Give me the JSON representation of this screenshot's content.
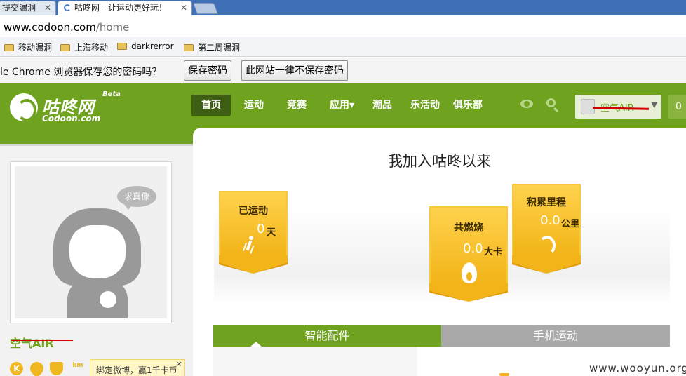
{
  "browser": {
    "tabs": [
      {
        "title": "提交漏洞"
      },
      {
        "title": "咕咚网 - 让运动更好玩！"
      }
    ],
    "url": {
      "host": "www.codoon.com",
      "path": "/home"
    },
    "bookmarks": [
      "移动漏洞",
      "上海移动",
      "darkrerror",
      "第二周漏洞"
    ],
    "password_prompt": {
      "message": "le Chrome 浏览器保存您的密码吗？",
      "save_label": "保存密码",
      "never_label": "此网站一律不保存密码"
    }
  },
  "site": {
    "logo": {
      "cn": "咕咚网",
      "en": "Codoon.com",
      "beta": "Beta"
    },
    "nav": [
      "首页",
      "运动",
      "竞赛",
      "应用▾",
      "潮品",
      "乐活动",
      "俱乐部"
    ],
    "user_name": "空气AIR",
    "message_count": "0"
  },
  "profile": {
    "avatar_bubble": "求真像",
    "name": "空气AIR",
    "icons": [
      "K",
      "",
      "",
      "km"
    ],
    "tooltip": "绑定微博，赢1千卡币",
    "tooltip_close": "×"
  },
  "summary": {
    "title": "我加入咕咚以来",
    "cards": [
      {
        "title": "已运动",
        "value": "0",
        "unit": "天"
      },
      {
        "title": "共燃烧",
        "value": "0.0",
        "unit": "大卡"
      },
      {
        "title": "积累里程",
        "value": "0.0",
        "unit": "公里"
      }
    ],
    "tabs": [
      "智能配件",
      "手机运动"
    ]
  },
  "watermark": "www.wooyun.org",
  "colors": {
    "brand_green": "#6fa21e",
    "badge_yellow": "#f2b418",
    "strike_red": "#d10000"
  }
}
